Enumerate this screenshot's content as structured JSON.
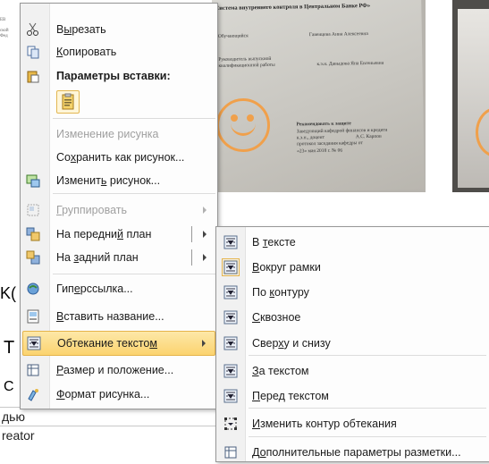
{
  "document": {
    "left_text": [
      "ЕВ",
      "ской",
      "Фед"
    ],
    "photo": {
      "title": "«Система внутреннего контроля в Центральном Банке РФ»",
      "lines": [
        "Обучающийся",
        "Гавенцева Анна Алексеевна",
        "Руководитель выпускной",
        "квалификационной работы",
        "к.э.н. Давыдова Яна Евгеньевна",
        "Рекомендовать к защите",
        "Заведующий кафедрой финансов и кредита",
        "к.э.н., доцент",
        "А.С. Карпов",
        "протокол заседания кафедры от",
        "«23» мая 2018 г. № 06"
      ]
    },
    "side_chars": [
      "(",
      "K(",
      "T",
      "C"
    ],
    "bottom_rows": [
      "дью",
      "reator"
    ]
  },
  "menu": {
    "items": [
      {
        "label": "Вырезать",
        "mn": "ы",
        "icon": "scissors-icon"
      },
      {
        "label": "Копировать",
        "mn": "К",
        "icon": "copy-icon"
      },
      {
        "label": "Параметры вставки:",
        "icon": "paste-icon",
        "header": true
      },
      {
        "label": "Изменение рисунка",
        "icon": "",
        "disabled": true
      },
      {
        "label": "Сохранить как рисунок...",
        "mn": "х",
        "icon": ""
      },
      {
        "label": "Изменить рисунок...",
        "mn": "ь",
        "icon": "change-picture-icon"
      },
      {
        "label": "Группировать",
        "mn": "Г",
        "icon": "group-icon",
        "disabled": true,
        "submenu": true
      },
      {
        "label": "На передний план",
        "mn": "й",
        "icon": "bring-forward-icon",
        "split": true
      },
      {
        "label": "На задний план",
        "mn": "з",
        "icon": "send-backward-icon",
        "split": true
      },
      {
        "label": "Гиперссылка...",
        "mn": "е",
        "icon": "hyperlink-icon"
      },
      {
        "label": "Вставить название...",
        "mn": "В",
        "icon": "insert-caption-icon"
      },
      {
        "label": "Обтекание текстом",
        "mn": "м",
        "icon": "text-wrap-icon",
        "active": true,
        "submenu": true
      },
      {
        "label": "Размер и положение...",
        "mn": "Р",
        "icon": "size-position-icon"
      },
      {
        "label": "Формат рисунка...",
        "mn": "Ф",
        "icon": "format-picture-icon"
      }
    ]
  },
  "submenu": {
    "items": [
      {
        "label": "В тексте",
        "mn": "т",
        "icon": "inline-wrap-icon"
      },
      {
        "label": "Вокруг рамки",
        "mn": "В",
        "icon": "square-wrap-icon",
        "checked": true
      },
      {
        "label": "По контуру",
        "mn": "к",
        "icon": "tight-wrap-icon"
      },
      {
        "label": "Сквозное",
        "mn": "С",
        "icon": "through-wrap-icon"
      },
      {
        "label": "Сверху и снизу",
        "mn": "х",
        "icon": "top-bottom-wrap-icon"
      },
      {
        "label": "За текстом",
        "mn": "З",
        "icon": "behind-text-icon"
      },
      {
        "label": "Перед текстом",
        "mn": "П",
        "icon": "in-front-text-icon"
      },
      {
        "label": "Изменить контур обтекания",
        "mn": "И",
        "icon": "edit-wrap-points-icon"
      },
      {
        "label": "Дополнительные параметры разметки...",
        "mn": "о",
        "icon": "more-layout-options-icon"
      }
    ]
  }
}
